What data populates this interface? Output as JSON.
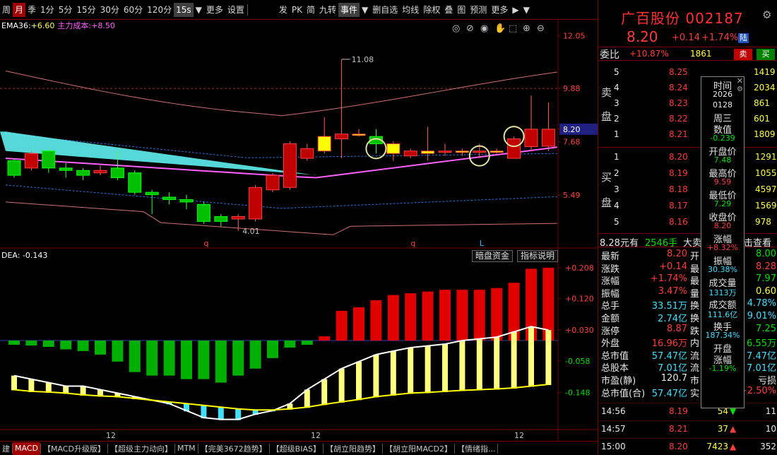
{
  "toolbar": {
    "items": [
      "周",
      "月",
      "季",
      "1分",
      "5分",
      "15分",
      "30分",
      "60分",
      "120分",
      "15s",
      "▼",
      "更多",
      "设置"
    ],
    "right_items": [
      "发",
      "PK",
      "简",
      "九转",
      "事件",
      "▼",
      "删自选",
      "均线",
      "除权",
      "叠",
      "图",
      "预测",
      "更多",
      "▶",
      "▼"
    ],
    "active_index": 1
  },
  "indicator_main": {
    "ema36_label": "EMA36:",
    "ema36_value": "+6.60",
    "cost_label": "主力成本:",
    "cost_value": "+8.50"
  },
  "price_axis": [
    "12.05",
    "9.88",
    "8.20",
    "7.68",
    "5.49"
  ],
  "annotations": {
    "high": "11.08",
    "low": "4.01",
    "marks": [
      "q",
      "q",
      "L"
    ]
  },
  "macd_header": {
    "label": "DEA: -0.143"
  },
  "macd_axis": [
    "+0.208",
    "+0.120",
    "+0.030",
    "-0.058",
    "-0.148"
  ],
  "buttons": {
    "dark_pool": "暗盘资金",
    "indicator_help": "指标说明"
  },
  "x_axis": [
    "12",
    "12",
    "12"
  ],
  "tabs": [
    "建",
    "MACD",
    "【MACD升级版】",
    "【超级主力动向】",
    "MTM",
    "【完美3672趋势】",
    "【超级BIAS】",
    "【胡立阳趋势】",
    "【胡立阳MACD2】",
    "【情绪指..."
  ],
  "active_tab": 1,
  "stock": {
    "name": "广百股份",
    "code": "002187",
    "price": "8.20",
    "change": "+0.14",
    "pct": "+1.74%",
    "badge": "陆"
  },
  "weibi": {
    "label": "委比",
    "value": "+10.87%",
    "diff": "1861",
    "sell_btn": "卖",
    "buy_btn": "买"
  },
  "sell_side_label": [
    "卖",
    "盘"
  ],
  "buy_side_label": [
    "买",
    "盘"
  ],
  "sell_orders": [
    {
      "lvl": "5",
      "price": "8.25",
      "vol": "1419"
    },
    {
      "lvl": "4",
      "price": "8.24",
      "vol": "2034"
    },
    {
      "lvl": "3",
      "price": "8.23",
      "vol": "861"
    },
    {
      "lvl": "2",
      "price": "8.22",
      "vol": "601"
    },
    {
      "lvl": "1",
      "price": "8.21",
      "vol": "1809"
    }
  ],
  "buy_orders": [
    {
      "lvl": "1",
      "price": "8.20",
      "vol": "1291"
    },
    {
      "lvl": "2",
      "price": "8.19",
      "vol": "1055"
    },
    {
      "lvl": "3",
      "price": "8.18",
      "vol": "4597"
    },
    {
      "lvl": "4",
      "price": "8.17",
      "vol": "1569"
    },
    {
      "lvl": "5",
      "price": "8.16",
      "vol": "978"
    }
  ],
  "big_order": {
    "amount": "8.28元有",
    "hands": "2546手",
    "label": "大卖单",
    "link": "击查看"
  },
  "stats": [
    {
      "l": "最新",
      "v": "8.20",
      "c": "red",
      "r": "开",
      "rv": "8.00",
      "rc": "green"
    },
    {
      "l": "涨跌",
      "v": "+0.14",
      "c": "red",
      "r": "最",
      "rv": "8.28",
      "rc": "red"
    },
    {
      "l": "涨幅",
      "v": "+1.74%",
      "c": "red",
      "r": "最",
      "rv": "7.97",
      "rc": "green"
    },
    {
      "l": "振幅",
      "v": "3.47%",
      "c": "red",
      "r": "量",
      "rv": "0.60",
      "rc": "yellow"
    },
    {
      "l": "总手",
      "v": "33.51万",
      "c": "cyan",
      "r": "换",
      "rv": "4.78%",
      "rc": "cyan"
    },
    {
      "l": "金额",
      "v": "2.74亿",
      "c": "cyan",
      "r": "换",
      "rv": "9.01%",
      "rc": "cyan"
    },
    {
      "l": "涨停",
      "v": "8.87",
      "c": "red",
      "r": "跌",
      "rv": "7.25",
      "rc": "green"
    },
    {
      "l": "外盘",
      "v": "16.96万",
      "c": "red",
      "r": "内",
      "rv": "6.55万",
      "rc": "green"
    },
    {
      "l": "总市值",
      "v": "57.47亿",
      "c": "cyan",
      "r": "流",
      "rv": "7.47亿",
      "rc": "cyan"
    },
    {
      "l": "总股本",
      "v": "7.01亿",
      "c": "cyan",
      "r": "流",
      "rv": "7.01亿",
      "rc": "cyan"
    },
    {
      "l": "市盈(静)",
      "v": "120.7",
      "c": "white",
      "r": "市",
      "rv": "亏损",
      "rc": "white"
    },
    {
      "l": "总市值(合)",
      "v": "57.47亿",
      "c": "cyan",
      "r": "实",
      "rv": "+2.50%",
      "rc": "red"
    }
  ],
  "ticks": [
    {
      "t": "14:56",
      "p": "8.19",
      "v": "54",
      "arrow": "down",
      "n": "11"
    },
    {
      "t": "14:57",
      "p": "8.21",
      "v": "37",
      "arrow": "up",
      "n": "10"
    },
    {
      "t": "15:00",
      "p": "8.20",
      "v": "7423",
      "arrow": "up",
      "n": "352"
    }
  ],
  "popup": {
    "close": "✕",
    "rows": [
      {
        "l": "时间",
        "v": "2026",
        "c": "white"
      },
      {
        "l": "",
        "v": "0128",
        "c": "white"
      },
      {
        "l": "周三",
        "v": "",
        "c": "white"
      },
      {
        "l": "数值",
        "v": "-0.239",
        "c": "green"
      },
      {
        "l": "开盘价",
        "v": "7.48",
        "c": "green"
      },
      {
        "l": "最高价",
        "v": "9.59",
        "c": "red"
      },
      {
        "l": "最低价",
        "v": "7.29",
        "c": "green"
      },
      {
        "l": "收盘价",
        "v": "8.20",
        "c": "red"
      },
      {
        "l": "涨幅",
        "v": "+8.32%",
        "c": "red"
      },
      {
        "l": "振幅",
        "v": "30.38%",
        "c": "cyan"
      },
      {
        "l": "成交量",
        "v": "1313万",
        "c": "cyan"
      },
      {
        "l": "成交额",
        "v": "111.6亿",
        "c": "cyan"
      },
      {
        "l": "换手",
        "v": "187.34%",
        "c": "cyan"
      },
      {
        "l": "开盘",
        "v": "",
        "c": "white"
      },
      {
        "l": "涨幅",
        "v": "-1.19%",
        "c": "green"
      }
    ]
  },
  "chart_data": {
    "type": "candlestick",
    "price_range": [
      3.8,
      12.3
    ],
    "candles": [
      {
        "o": 6.9,
        "c": 6.3,
        "h": 7.0,
        "l": 6.2
      },
      {
        "o": 6.6,
        "c": 7.2,
        "h": 7.3,
        "l": 6.5
      },
      {
        "o": 7.3,
        "c": 6.6,
        "h": 7.4,
        "l": 6.4
      },
      {
        "o": 6.6,
        "c": 6.5,
        "h": 6.8,
        "l": 6.2
      },
      {
        "o": 6.5,
        "c": 6.3,
        "h": 6.6,
        "l": 6.1
      },
      {
        "o": 6.4,
        "c": 6.5,
        "h": 6.7,
        "l": 6.3
      },
      {
        "o": 6.6,
        "c": 6.2,
        "h": 7.3,
        "l": 6.1
      },
      {
        "o": 6.4,
        "c": 5.6,
        "h": 6.5,
        "l": 5.5
      },
      {
        "o": 5.6,
        "c": 5.5,
        "h": 5.7,
        "l": 4.7
      },
      {
        "o": 5.4,
        "c": 5.3,
        "h": 5.6,
        "l": 5.1
      },
      {
        "o": 5.3,
        "c": 5.2,
        "h": 5.5,
        "l": 4.9
      },
      {
        "o": 5.1,
        "c": 4.4,
        "h": 5.2,
        "l": 4.3
      },
      {
        "o": 4.6,
        "c": 4.4,
        "h": 4.7,
        "l": 4.2
      },
      {
        "o": 4.5,
        "c": 4.6,
        "h": 4.7,
        "l": 4.01
      },
      {
        "o": 4.5,
        "c": 5.8,
        "h": 5.9,
        "l": 4.4
      },
      {
        "o": 5.7,
        "c": 6.3,
        "h": 6.4,
        "l": 5.6
      },
      {
        "o": 5.8,
        "c": 7.6,
        "h": 7.7,
        "l": 5.7
      },
      {
        "o": 7.0,
        "c": 7.4,
        "h": 7.6,
        "l": 6.9
      },
      {
        "o": 7.3,
        "c": 7.9,
        "h": 8.7,
        "l": 7.2
      },
      {
        "o": 7.8,
        "c": 8.0,
        "h": 11.08,
        "l": 7.0
      },
      {
        "o": 8.0,
        "c": 8.0,
        "h": 8.2,
        "l": 7.9
      },
      {
        "o": 7.9,
        "c": 7.6,
        "h": 8.2,
        "l": 7.2
      },
      {
        "o": 7.2,
        "c": 7.6,
        "h": 7.7,
        "l": 6.9
      },
      {
        "o": 7.1,
        "c": 7.3,
        "h": 7.4,
        "l": 7.0
      },
      {
        "o": 7.2,
        "c": 7.3,
        "h": 8.3,
        "l": 6.9
      },
      {
        "o": 7.3,
        "c": 7.3,
        "h": 7.6,
        "l": 7.1
      },
      {
        "o": 7.3,
        "c": 7.3,
        "h": 7.4,
        "l": 7.1
      },
      {
        "o": 7.3,
        "c": 7.3,
        "h": 7.6,
        "l": 7.0
      },
      {
        "o": 7.3,
        "c": 7.3,
        "h": 7.4,
        "l": 7.2
      },
      {
        "o": 7.0,
        "c": 7.8,
        "h": 7.9,
        "l": 7.0
      },
      {
        "o": 7.48,
        "c": 8.2,
        "h": 9.59,
        "l": 7.29
      },
      {
        "o": 7.5,
        "c": 8.2,
        "h": 9.3,
        "l": 7.3
      }
    ],
    "macd_hist": [
      -0.012,
      -0.014,
      -0.018,
      -0.025,
      -0.03,
      -0.04,
      -0.06,
      -0.09,
      -0.1,
      -0.1,
      -0.11,
      -0.11,
      -0.12,
      -0.1,
      -0.08,
      -0.05,
      -0.02,
      -0.012,
      0.012,
      0.085,
      0.095,
      0.115,
      0.13,
      0.135,
      0.14,
      0.145,
      0.145,
      0.145,
      0.15,
      0.165,
      0.205,
      0.208
    ],
    "dif": [
      -0.1,
      -0.11,
      -0.12,
      -0.13,
      -0.13,
      -0.14,
      -0.15,
      -0.16,
      -0.17,
      -0.18,
      -0.2,
      -0.22,
      -0.225,
      -0.225,
      -0.21,
      -0.2,
      -0.18,
      -0.14,
      -0.11,
      -0.08,
      -0.06,
      -0.04,
      -0.03,
      -0.02,
      -0.015,
      -0.01,
      -0.0,
      0.005,
      0.01,
      0.025,
      0.04,
      0.03
    ],
    "dea": [
      -0.14,
      -0.145,
      -0.147,
      -0.15,
      -0.155,
      -0.158,
      -0.16,
      -0.165,
      -0.17,
      -0.175,
      -0.18,
      -0.185,
      -0.19,
      -0.195,
      -0.198,
      -0.198,
      -0.195,
      -0.19,
      -0.182,
      -0.175,
      -0.168,
      -0.16,
      -0.155,
      -0.15,
      -0.148,
      -0.145,
      -0.142,
      -0.14,
      -0.138,
      -0.135,
      -0.13,
      -0.125
    ],
    "macd_range": [
      -0.25,
      0.23
    ]
  }
}
